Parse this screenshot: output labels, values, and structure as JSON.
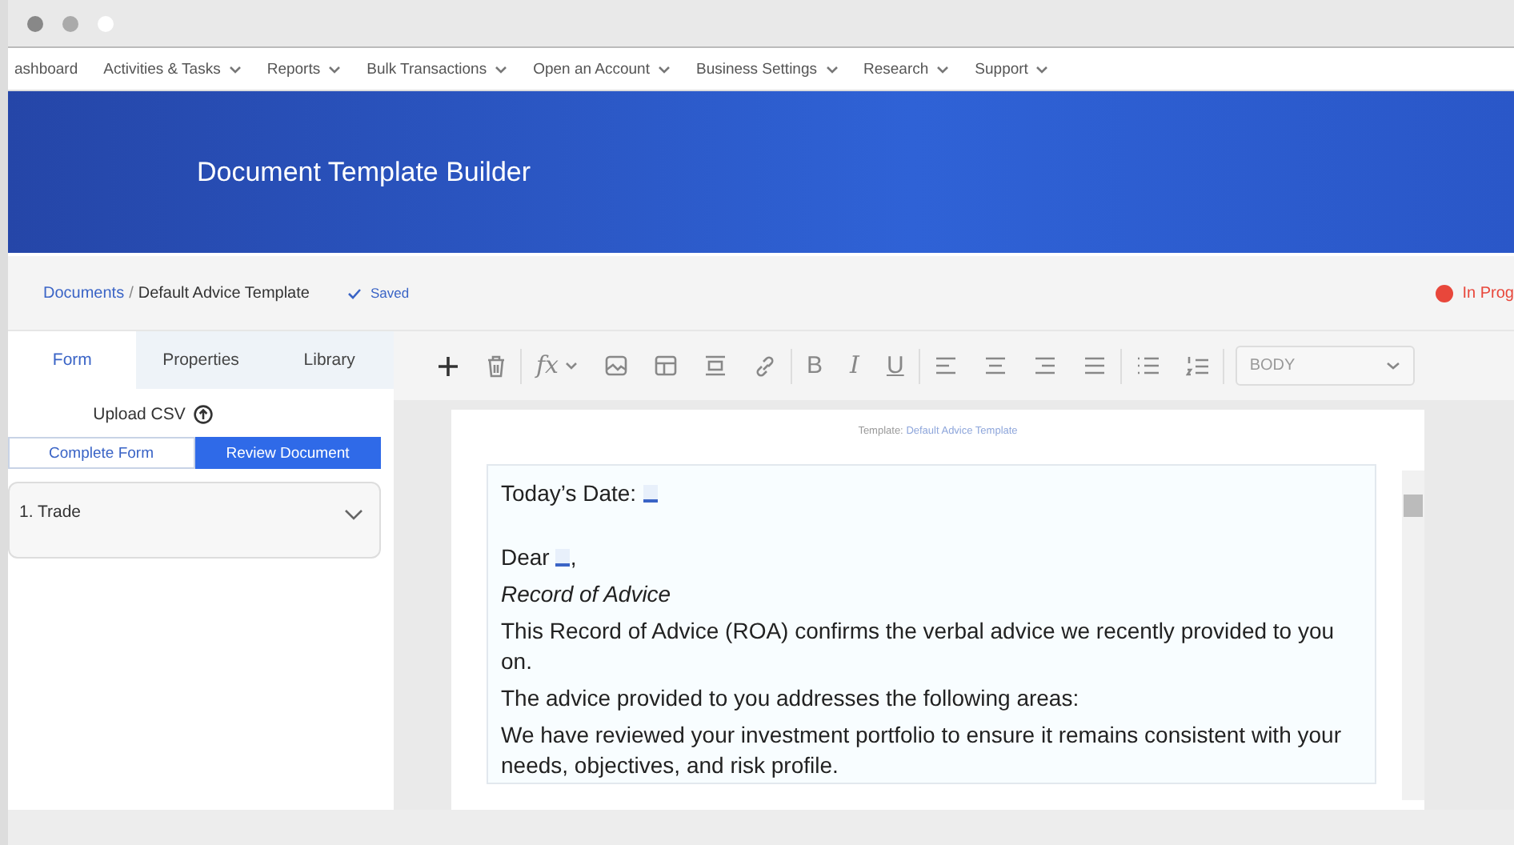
{
  "nav": {
    "items": [
      {
        "label": "ashboard",
        "has_menu": false
      },
      {
        "label": "Activities & Tasks",
        "has_menu": true
      },
      {
        "label": "Reports",
        "has_menu": true
      },
      {
        "label": "Bulk Transactions",
        "has_menu": true
      },
      {
        "label": "Open an Account",
        "has_menu": true
      },
      {
        "label": "Business Settings",
        "has_menu": true
      },
      {
        "label": "Research",
        "has_menu": true
      },
      {
        "label": "Support",
        "has_menu": true
      }
    ]
  },
  "banner": {
    "title": "Document Template Builder"
  },
  "breadcrumb": {
    "parent": "Documents",
    "separator": "/",
    "current": "Default Advice Template",
    "save_status": "Saved"
  },
  "status": {
    "label": "In Prog",
    "color": "#e8473b"
  },
  "panel": {
    "tabs": [
      {
        "label": "Form",
        "selected": true
      },
      {
        "label": "Properties",
        "selected": false
      },
      {
        "label": "Library",
        "selected": false
      }
    ],
    "upload_button": "Upload CSV",
    "mode_toggle": [
      {
        "label": "Complete Form",
        "selected": false
      },
      {
        "label": "Review Document",
        "selected": true
      }
    ],
    "sections": [
      {
        "label": "1. Trade",
        "expanded": false
      }
    ]
  },
  "toolbar": {
    "groups": [
      [
        {
          "kind": "add"
        },
        {
          "kind": "delete"
        }
      ],
      [
        {
          "kind": "formula",
          "label": "fx"
        },
        {
          "kind": "image"
        },
        {
          "kind": "table"
        },
        {
          "kind": "divider"
        },
        {
          "kind": "link"
        }
      ],
      [
        {
          "kind": "bold",
          "label": "B"
        },
        {
          "kind": "italic",
          "label": "I"
        },
        {
          "kind": "underline",
          "label": "U"
        }
      ],
      [
        {
          "kind": "align-left"
        },
        {
          "kind": "align-center"
        },
        {
          "kind": "align-right"
        },
        {
          "kind": "align-justify"
        }
      ],
      [
        {
          "kind": "bullets"
        },
        {
          "kind": "numbers"
        }
      ]
    ],
    "style_select": "BODY"
  },
  "document": {
    "template_label": "Template:",
    "template_name": "Default Advice Template",
    "paragraphs": [
      {
        "kind": "field",
        "text": "Today’s Date:"
      },
      {
        "kind": "blank"
      },
      {
        "kind": "field",
        "text": "Dear",
        "suffix": ","
      },
      {
        "kind": "italic",
        "text": "Record of Advice"
      },
      {
        "kind": "plain",
        "text": "This Record of Advice (ROA) confirms the verbal advice we recently provided to you on."
      },
      {
        "kind": "plain",
        "text": "The advice provided to you addresses the following areas:"
      },
      {
        "kind": "plain",
        "text": "We have reviewed your investment portfolio to ensure it remains consistent with your needs, objectives, and risk profile."
      }
    ]
  }
}
